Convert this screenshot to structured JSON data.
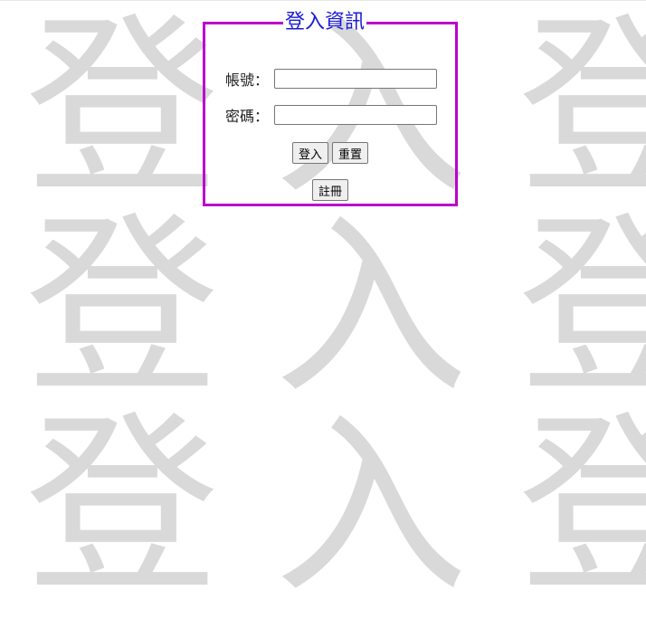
{
  "background_watermark": {
    "glyphs": [
      "登",
      "入",
      "登",
      "登",
      "入",
      "登",
      "登",
      "入",
      "登"
    ],
    "color": "#d9d9d9"
  },
  "login_panel": {
    "legend": "登入資訊",
    "legend_color": "#1a1ad6",
    "border_color": "#bb00cc",
    "account_label": "帳號：",
    "account_value": "",
    "password_label": "密碼：",
    "password_value": "",
    "login_button": "登入",
    "reset_button": "重置",
    "register_button": "註冊"
  }
}
